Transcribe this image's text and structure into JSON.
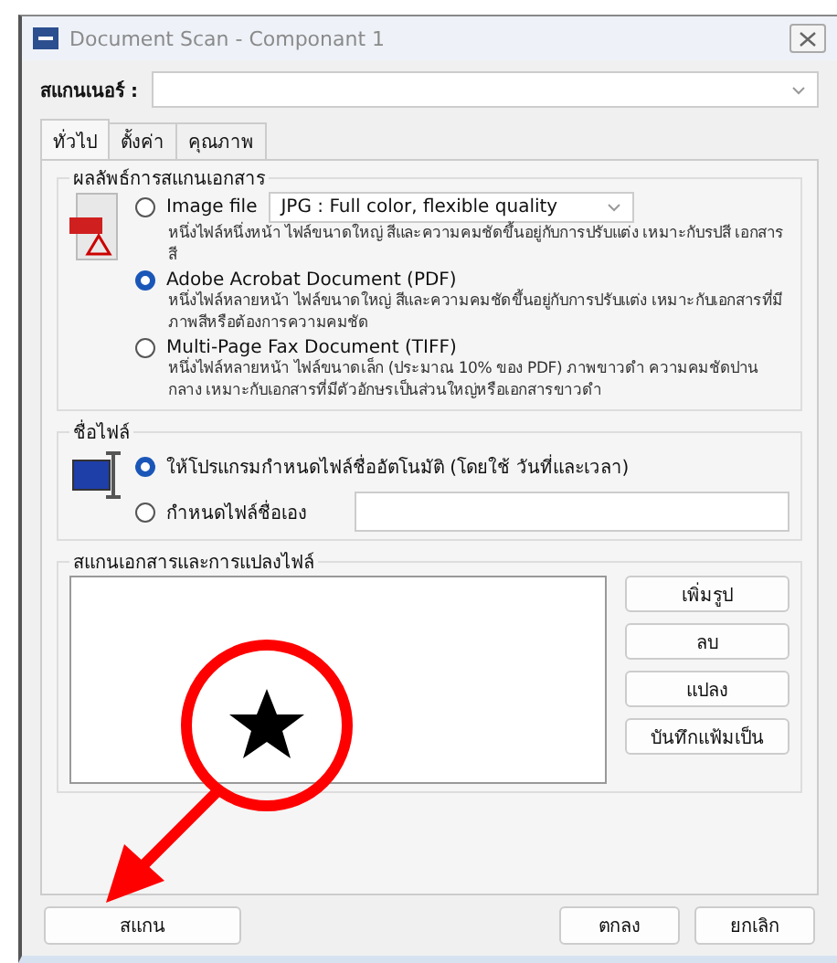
{
  "window": {
    "title": "Document Scan - Componant 1"
  },
  "scanner": {
    "label": "สแกนเนอร์ :"
  },
  "tabs": [
    {
      "label": "ทั่วไป",
      "selected": true
    },
    {
      "label": "ตั้งค่า",
      "selected": false
    },
    {
      "label": "คุณภาพ",
      "selected": false
    }
  ],
  "output_group": {
    "title": "ผลลัพธ์การสแกนเอกสาร",
    "options": [
      {
        "label": "Image file",
        "selected": false,
        "format": "JPG : Full color, flexible quality",
        "description": "หนึ่งไฟล์หนึ่งหน้า ไฟล์ขนาดใหญ่ สีและความคมชัดขึ้นอยู่กับการปรับแต่ง เหมาะกับรปสี เอกสารสี"
      },
      {
        "label": "Adobe Acrobat Document (PDF)",
        "selected": true,
        "description": "หนึ่งไฟล์หลายหน้า ไฟล์ขนาดใหญ่ สีและความคมชัดขึ้นอยู่กับการปรับแต่ง เหมาะกับเอกสารที่มีภาพสีหรือต้องการความคมชัด"
      },
      {
        "label": "Multi-Page Fax Document (TIFF)",
        "selected": false,
        "description": "หนึ่งไฟล์หลายหน้า ไฟล์ขนาดเล็ก (ประมาณ 10% ของ PDF) ภาพขาวดำ ความคมชัดปานกลาง เหมาะกับเอกสารที่มีตัวอักษรเป็นส่วนใหญ่หรือเอกสารขาวดำ"
      }
    ]
  },
  "filename_group": {
    "title": "ชื่อไฟล์",
    "options": [
      {
        "label": "ให้โปรแกรมกำหนดไฟล์ชื่ออัตโนมัติ (โดยใช้ วันที่และเวลา)",
        "selected": true,
        "kind": "plain"
      },
      {
        "label": "กำหนดไฟล์ชื่อเอง",
        "selected": false,
        "kind": "field"
      }
    ]
  },
  "scan_group": {
    "title": "สแกนเอกสารและการแปลงไฟล์",
    "buttons": [
      "เพิ่มรูป",
      "ลบ",
      "แปลง",
      "บันทึกแฟ้มเป็น"
    ]
  },
  "footer": {
    "scan_button": "สแกน",
    "buttons": [
      "ตกลง",
      "ยกเลิก"
    ]
  }
}
